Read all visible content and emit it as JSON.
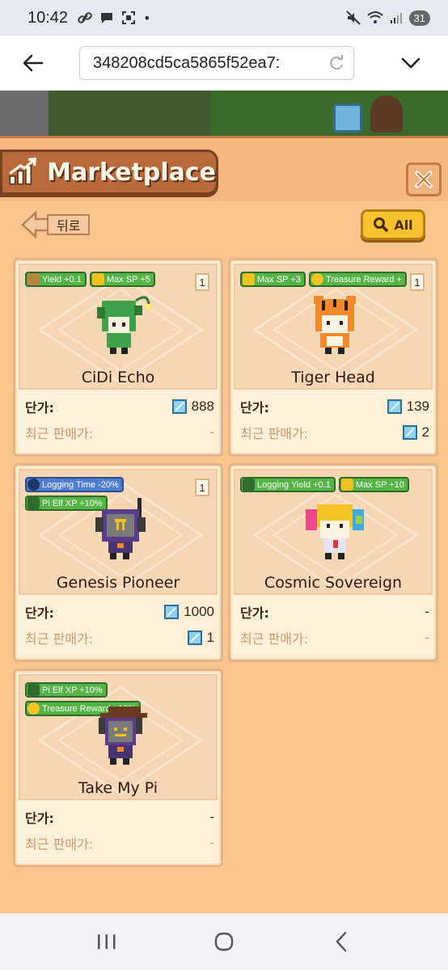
{
  "status_bar": {
    "time": "10:42",
    "battery": "31"
  },
  "browser": {
    "url": ":348208cd5ca5865f52ea7"
  },
  "marketplace": {
    "title": "Marketplace",
    "back_label": "뒤로",
    "filter_label": "All",
    "price_label": "단가:",
    "last_sale_label": "최근 판매가:",
    "items": [
      {
        "name": "CiDi Echo",
        "count": "1",
        "buffs": [
          {
            "label": "Yield +0.1",
            "icon": "log-icon",
            "color": "green"
          },
          {
            "label": "Max SP +5",
            "icon": "lightning-icon",
            "color": "green"
          }
        ],
        "price": "888",
        "last_sale": "-"
      },
      {
        "name": "Tiger Head",
        "count": "1",
        "buffs": [
          {
            "label": "Max SP +3",
            "icon": "lightning-icon",
            "color": "green"
          },
          {
            "label": "Treasure Reward +",
            "icon": "coin-icon",
            "color": "green"
          }
        ],
        "price": "139",
        "last_sale": "2"
      },
      {
        "name": "Genesis Pioneer",
        "count": "1",
        "buffs": [
          {
            "label": "Logging Time -20%",
            "icon": "clock-icon",
            "color": "blue"
          },
          {
            "label": "Pi Elf XP +10%",
            "icon": "trend-icon",
            "color": "green"
          }
        ],
        "price": "1000",
        "last_sale": "1"
      },
      {
        "name": "Cosmic Sovereign",
        "count": "",
        "buffs": [
          {
            "label": "Logging Yield +0.1",
            "icon": "trend-icon",
            "color": "green"
          },
          {
            "label": "Max SP +10",
            "icon": "lightning-icon",
            "color": "green"
          }
        ],
        "price": "-",
        "last_sale": "-"
      },
      {
        "name": "Take My Pi",
        "count": "",
        "buffs": [
          {
            "label": "Pi Elf XP +10%",
            "icon": "trend-icon",
            "color": "green"
          },
          {
            "label": "Treasure Reward +10%",
            "icon": "coin-icon",
            "color": "green"
          }
        ],
        "price": "-",
        "last_sale": "-"
      }
    ]
  },
  "colors": {
    "panel": "#f9c58f",
    "title_tab": "#b96a3c",
    "tag_green": "#55b446",
    "tag_blue": "#4f7ed1",
    "filter_button": "#f6c22e"
  }
}
